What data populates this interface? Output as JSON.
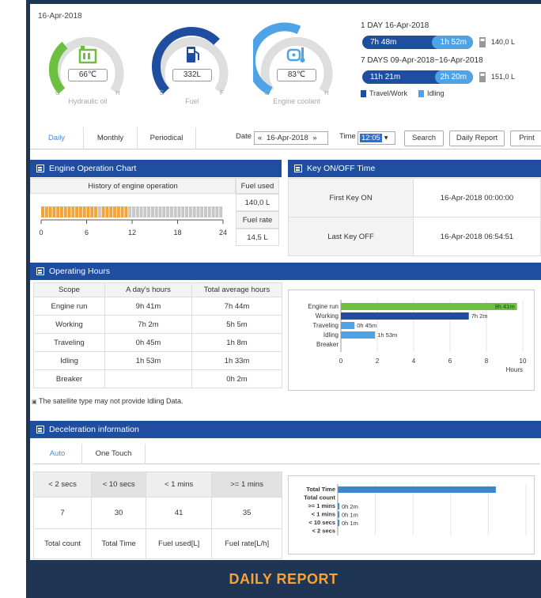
{
  "top": {
    "date": "16-Apr-2018",
    "gauges": [
      {
        "name": "Hydraulic oil",
        "value": "66℃",
        "lo": "C",
        "hi": "H",
        "color": "#6cbf3f",
        "icon": "hydraulic-oil-icon"
      },
      {
        "name": "Fuel",
        "value": "332L",
        "lo": "E",
        "hi": "F",
        "color": "#1f4ea0",
        "icon": "fuel-pump-icon"
      },
      {
        "name": "Engine coolant",
        "value": "83℃",
        "lo": "C",
        "hi": "H",
        "color": "#4da3e6",
        "icon": "engine-coolant-icon"
      }
    ],
    "fuel_summary": {
      "day_title": "1 DAY 16-Apr-2018",
      "day_work": "7h 48m",
      "day_idle": "1h 52m",
      "day_fuel": "140,0 L",
      "week_title": "7 DAYS 09-Apr-2018~16-Apr-2018",
      "week_work": "11h 21m",
      "week_idle": "2h 20m",
      "week_fuel": "151,0 L",
      "legend_work": "Travel/Work",
      "legend_idle": "Idling"
    }
  },
  "toolbar": {
    "tabs": [
      "Daily",
      "Monthly",
      "Periodical"
    ],
    "date_label": "Date",
    "date_value": "16-Apr-2018",
    "time_label": "Time",
    "time_value": "12:05",
    "search": "Search",
    "daily_report": "Daily Report",
    "print": "Print"
  },
  "engine_chart": {
    "title": "Engine Operation Chart",
    "history_label": "History of engine operation",
    "fuel_used_label": "Fuel used",
    "fuel_used": "140,0 L",
    "fuel_rate_label": "Fuel rate",
    "fuel_rate": "14,5 L",
    "ticks": [
      "0",
      "6",
      "12",
      "18",
      "24"
    ],
    "segments": [
      1,
      1,
      1,
      1,
      1,
      1,
      1,
      1,
      1,
      1,
      1,
      1,
      1,
      1,
      1,
      2,
      1,
      1,
      1,
      1,
      1,
      1,
      1,
      2,
      2,
      2,
      2,
      2,
      2,
      2,
      2,
      2,
      2,
      2,
      2,
      2,
      2,
      2,
      2,
      2,
      2,
      2,
      2,
      2,
      2,
      2,
      2,
      2
    ],
    "colors": {
      "work": "#f2a33a",
      "off": "#c8c8c8"
    }
  },
  "key": {
    "title": "Key ON/OFF Time",
    "first_label": "First Key ON",
    "first_value": "16-Apr-2018 00:00:00",
    "last_label": "Last Key OFF",
    "last_value": "16-Apr-2018 06:54:51"
  },
  "operating": {
    "title": "Operating Hours",
    "headers": [
      "Scope",
      "A day's hours",
      "Total average hours"
    ],
    "rows": [
      [
        "Engine run",
        "9h 41m",
        "7h 44m"
      ],
      [
        "Working",
        "7h 2m",
        "5h 5m"
      ],
      [
        "Traveling",
        "0h 45m",
        "1h 8m"
      ],
      [
        "Idling",
        "1h 53m",
        "1h 33m"
      ],
      [
        "Breaker",
        "",
        "0h 2m"
      ]
    ],
    "note": "The satellite type may not provide Idling Data."
  },
  "deceleration": {
    "title": "Deceleration information",
    "tabs": [
      "Auto",
      "One Touch"
    ],
    "headers": [
      "< 2 secs",
      "< 10 secs",
      "< 1 mins",
      ">= 1 mins"
    ],
    "values": [
      "7",
      "30",
      "41",
      "35"
    ],
    "footers": [
      "Total count",
      "Total Time",
      "Fuel used[L]",
      "Fuel rate[L/h]"
    ]
  },
  "chart_data": [
    {
      "type": "bar",
      "orientation": "horizontal",
      "categories": [
        "Engine run",
        "Working",
        "Traveling",
        "Idling",
        "Breaker"
      ],
      "values": [
        9.68,
        7.03,
        0.75,
        1.88,
        0
      ],
      "labels": [
        "9h 41m",
        "7h 2m",
        "0h 45m",
        "1h 53m",
        ""
      ],
      "colors": [
        "#6cbf3f",
        "#1f4ea0",
        "#4da3e6",
        "#4da3e6",
        "#4da3e6"
      ],
      "xlabel": "Hours",
      "xlim": [
        0,
        10
      ],
      "ticks": [
        0,
        2,
        4,
        6,
        8,
        10
      ],
      "grid": true
    },
    {
      "type": "bar",
      "orientation": "horizontal",
      "categories": [
        "Total Time",
        "Total count",
        ">= 1 mins",
        "< 1 mins",
        "< 10 secs",
        "< 2 secs"
      ],
      "values": [
        10,
        0,
        0.05,
        0.02,
        0.02,
        0
      ],
      "labels": [
        "",
        "",
        "0h 2m",
        "0h 1m",
        "0h 1m",
        ""
      ],
      "color": "#3b86cf",
      "grid": true
    }
  ]
}
